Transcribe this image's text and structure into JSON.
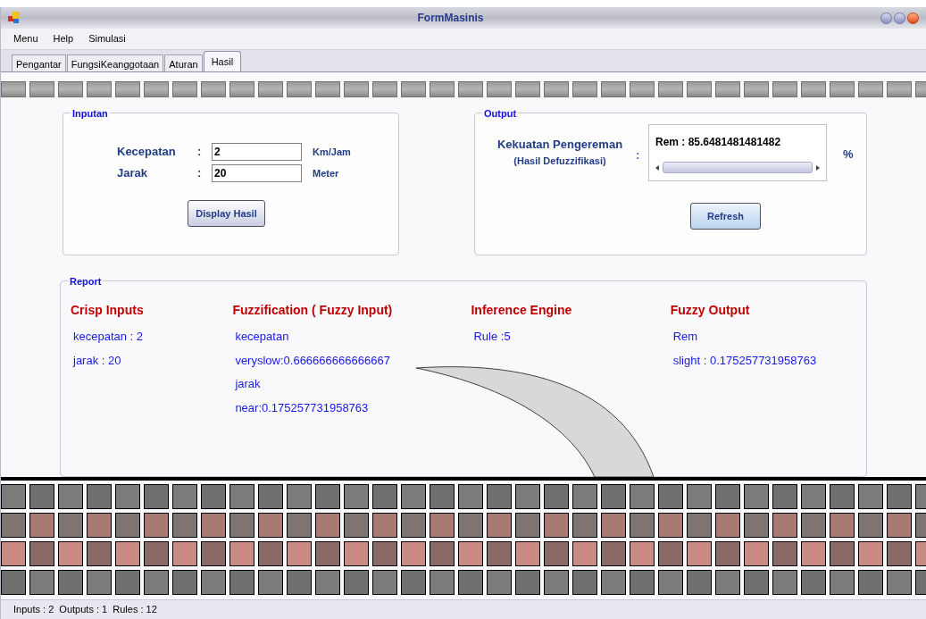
{
  "window": {
    "title": "FormMasinis"
  },
  "menu": [
    "Menu",
    "Help",
    "Simulasi"
  ],
  "tabs": [
    {
      "label": "Pengantar",
      "selected": false
    },
    {
      "label": "FungsiKeanggotaan",
      "selected": false
    },
    {
      "label": "Aturan",
      "selected": false
    },
    {
      "label": "Hasil",
      "selected": true
    }
  ],
  "inputan": {
    "title": "Inputan",
    "fields": [
      {
        "label": "Kecepatan",
        "separator": ":",
        "value": "2",
        "unit": "Km/Jam"
      },
      {
        "label": "Jarak",
        "separator": ":",
        "value": "20",
        "unit": "Meter"
      }
    ],
    "button": "Display Hasil"
  },
  "output": {
    "title": "Output",
    "label": "Kekuatan Pengereman",
    "sublabel": "(Hasil Defuzzifikasi)",
    "separator": ":",
    "value": "Rem : 85.6481481481482",
    "unit": "%",
    "button": "Refresh"
  },
  "report": {
    "title": "Report",
    "columns": [
      {
        "heading": "Crisp Inputs",
        "lines": [
          "kecepatan : 2",
          "jarak : 20"
        ]
      },
      {
        "heading": "Fuzzification ( Fuzzy Input)",
        "lines": [
          "kecepatan",
          "veryslow:0.666666666666667",
          "jarak",
          "near:0.175257731958763"
        ]
      },
      {
        "heading": "Inference Engine",
        "lines": [
          "Rule :5"
        ]
      },
      {
        "heading": "Fuzzy Output",
        "lines": [
          "Rem",
          "slight : 0.175257731958763"
        ]
      }
    ]
  },
  "status_bar": {
    "text": "Inputs : 2  Outputs : 1  Rules : 12"
  }
}
